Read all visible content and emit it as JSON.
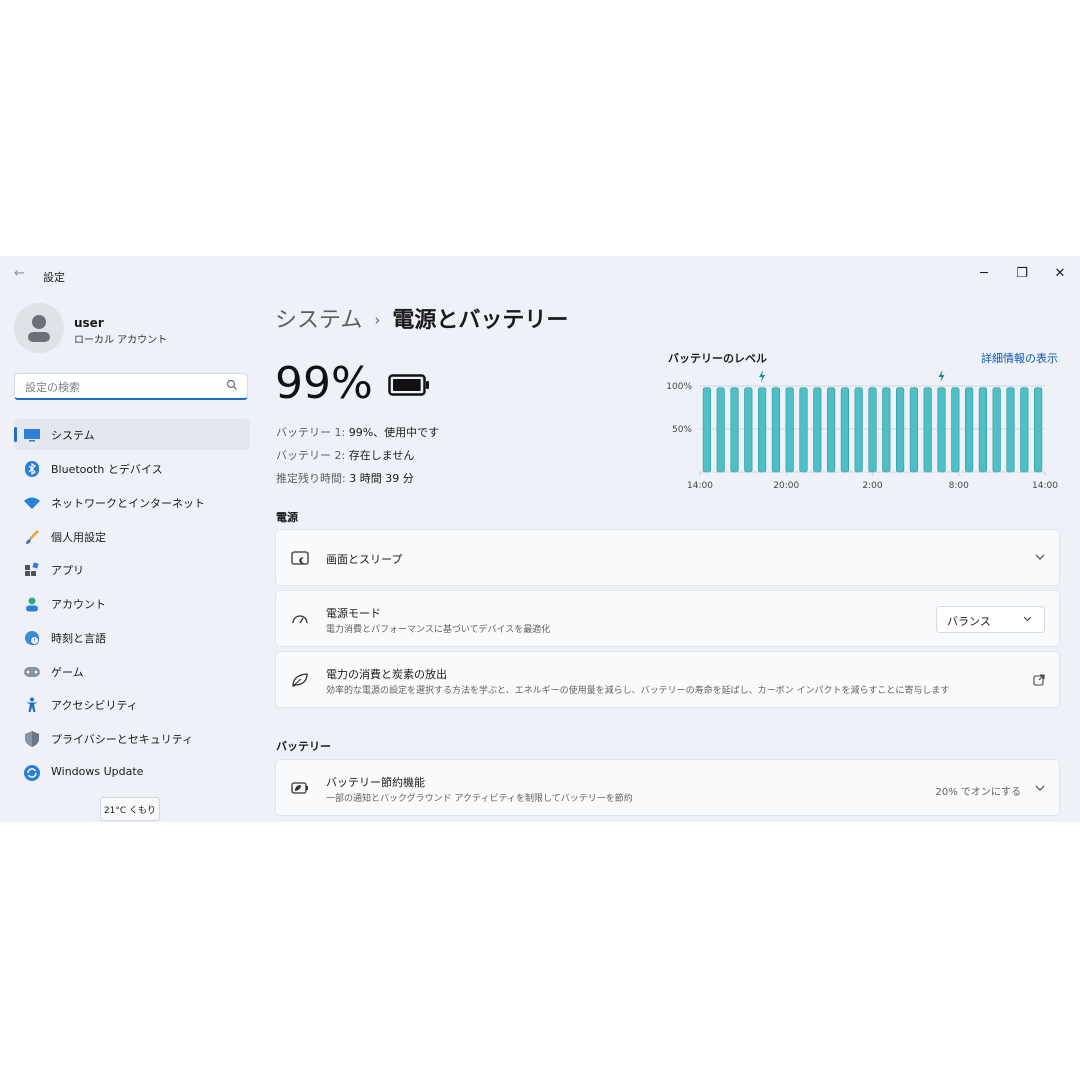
{
  "window": {
    "title": "設定",
    "back_glyph": "←",
    "minimize_glyph": "─",
    "maximize_glyph": "❐",
    "close_glyph": "✕"
  },
  "user": {
    "name": "user",
    "account_type": "ローカル アカウント"
  },
  "search": {
    "placeholder": "設定の検索"
  },
  "nav": [
    {
      "label": "システム",
      "icon": "monitor-icon",
      "active": true
    },
    {
      "label": "Bluetooth とデバイス",
      "icon": "bluetooth-icon"
    },
    {
      "label": "ネットワークとインターネット",
      "icon": "wifi-icon"
    },
    {
      "label": "個人用設定",
      "icon": "brush-icon"
    },
    {
      "label": "アプリ",
      "icon": "apps-icon"
    },
    {
      "label": "アカウント",
      "icon": "person-icon"
    },
    {
      "label": "時刻と言語",
      "icon": "globe-clock-icon"
    },
    {
      "label": "ゲーム",
      "icon": "gamepad-icon"
    },
    {
      "label": "アクセシビリティ",
      "icon": "accessibility-icon"
    },
    {
      "label": "プライバシーとセキュリティ",
      "icon": "shield-icon"
    },
    {
      "label": "Windows Update",
      "icon": "update-icon"
    }
  ],
  "weather": "21°C くもり",
  "breadcrumb": {
    "parent": "システム",
    "separator": "›",
    "current": "電源とバッテリー"
  },
  "battery": {
    "percent_label": "99%",
    "level": 0.99,
    "lines": [
      {
        "label": "バッテリー 1:",
        "value": "99%、使用中です"
      },
      {
        "label": "バッテリー 2:",
        "value": "存在しません"
      },
      {
        "label": "推定残り時間:",
        "value": "3 時間 39 分"
      }
    ]
  },
  "chart_title": "バッテリーのレベル",
  "chart_link": "詳細情報の表示",
  "chart_data": {
    "type": "bar",
    "title": "バッテリーのレベル",
    "x_tick_labels": [
      "14:00",
      "20:00",
      "2:00",
      "8:00",
      "14:00"
    ],
    "y_tick_labels": [
      "100%",
      "50%"
    ],
    "y_ticks": [
      100,
      50
    ],
    "ylim": [
      0,
      100
    ],
    "values": [
      98,
      98,
      98,
      98,
      98,
      98,
      98,
      98,
      98,
      98,
      98,
      98,
      98,
      98,
      98,
      98,
      98,
      98,
      98,
      98,
      98,
      98,
      98,
      98,
      98
    ],
    "charging_markers": [
      4,
      17
    ],
    "grid": true,
    "bar_color": "#4fbfc4"
  },
  "sections": {
    "power": "電源",
    "battery": "バッテリー"
  },
  "cards": {
    "screen_sleep": {
      "title": "画面とスリープ"
    },
    "power_mode": {
      "title": "電源モード",
      "subtitle": "電力消費とパフォーマンスに基づいてデバイスを最適化",
      "value": "バランス"
    },
    "energy": {
      "title": "電力の消費と炭素の放出",
      "subtitle": "効率的な電源の設定を選択する方法を学ぶと、エネルギーの使用量を減らし、バッテリーの寿命を延ばし、カーボン インパクトを減らすことに寄与します"
    },
    "saver": {
      "title": "バッテリー節約機能",
      "subtitle": "一部の通知とバックグラウンド アクティビティを制限してバッテリーを節約",
      "value": "20% でオンにする"
    }
  },
  "colors": {
    "accent": "#1f6fbf",
    "link": "#0f5bb5",
    "chart_bar": "#4fbfc4",
    "window_bg": "#eef2f8"
  }
}
